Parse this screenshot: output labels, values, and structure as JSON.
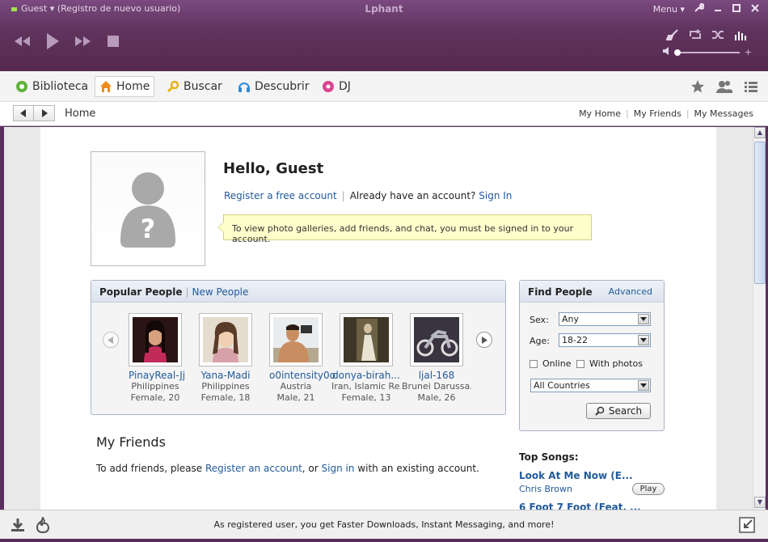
{
  "titlebar": {
    "user_label": "Guest ▾ (Registro de nuevo usuario)",
    "app_title": "Lphant",
    "menu_label": "Menu ▾"
  },
  "nav": {
    "tabs": [
      {
        "label": "Biblioteca",
        "icon": "library-icon"
      },
      {
        "label": "Home",
        "icon": "home-icon"
      },
      {
        "label": "Buscar",
        "icon": "search-icon"
      },
      {
        "label": "Descubrir",
        "icon": "discover-icon"
      },
      {
        "label": "DJ",
        "icon": "dj-icon"
      }
    ],
    "active_tab": "Home"
  },
  "breadcrumb": {
    "current": "Home",
    "links": [
      "My Home",
      "My Friends",
      "My Messages"
    ]
  },
  "profile": {
    "greeting": "Hello, Guest",
    "register_link": "Register a free account",
    "already_text": "Already have an account?",
    "signin_link": "Sign In",
    "notice": "To view photo galleries, add friends, and chat, you must be signed in to your account."
  },
  "popular": {
    "tab_active": "Popular People",
    "tab_other": "New People",
    "people": [
      {
        "name": "PinayReal-Jj",
        "country": "Philippines",
        "info": "Female, 20"
      },
      {
        "name": "Yana-Madi",
        "country": "Philippines",
        "info": "Female, 18"
      },
      {
        "name": "o0intensity0o",
        "country": "Austria",
        "info": "Male, 21"
      },
      {
        "name": "donya-birah...",
        "country": "Iran, Islamic Re...",
        "info": "Female, 13"
      },
      {
        "name": "ljal-168",
        "country": "Brunei Darussa...",
        "info": "Male, 26"
      }
    ]
  },
  "find": {
    "title": "Find People",
    "advanced": "Advanced",
    "sex_label": "Sex:",
    "sex_value": "Any",
    "age_label": "Age:",
    "age_value": "18-22",
    "online_label": "Online",
    "photos_label": "With photos",
    "country_value": "All Countries",
    "search_label": "Search"
  },
  "friends": {
    "title": "My Friends",
    "text_before": "To add friends, please",
    "register_link": "Register an account",
    "text_mid": ", or",
    "signin_link": "Sign in",
    "text_after": "with an existing account."
  },
  "top_songs": {
    "title": "Top Songs:",
    "songs": [
      {
        "title": "Look At Me Now (E...",
        "artist": "Chris Brown",
        "play": "Play"
      },
      {
        "title": "6 Foot 7 Foot (Feat. ..."
      }
    ]
  },
  "bottom": {
    "message": "As registered user, you get Faster Downloads, Instant Messaging, and more!"
  },
  "colors": {
    "titlebar": "#61345f",
    "link": "#225a9a",
    "notice_bg": "#ffffcc"
  }
}
